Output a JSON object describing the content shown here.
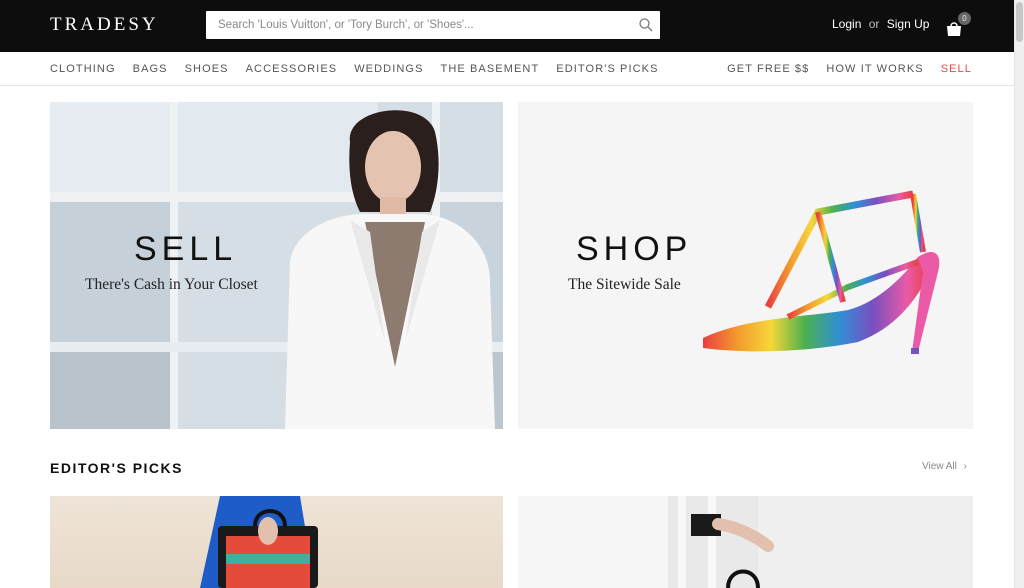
{
  "header": {
    "logo": "TRADESY",
    "search_placeholder": "Search 'Louis Vuitton', or 'Tory Burch', or 'Shoes'...",
    "login": "Login",
    "or": "or",
    "signup": "Sign Up",
    "cart_count": "0"
  },
  "nav": {
    "left": [
      "CLOTHING",
      "BAGS",
      "SHOES",
      "ACCESSORIES",
      "WEDDINGS",
      "THE BASEMENT",
      "EDITOR'S PICKS"
    ],
    "right": [
      "GET FREE $$",
      "HOW IT WORKS",
      "SELL"
    ]
  },
  "hero": {
    "sell_title": "SELL",
    "sell_subtitle": "There's Cash in Your Closet",
    "shop_title": "SHOP",
    "shop_subtitle": "The Sitewide Sale"
  },
  "editors_picks": {
    "title": "EDITOR'S PICKS",
    "view_all": "View All"
  },
  "colors": {
    "topbar": "#0d0d0d",
    "accent_sell": "#e34b4b"
  }
}
